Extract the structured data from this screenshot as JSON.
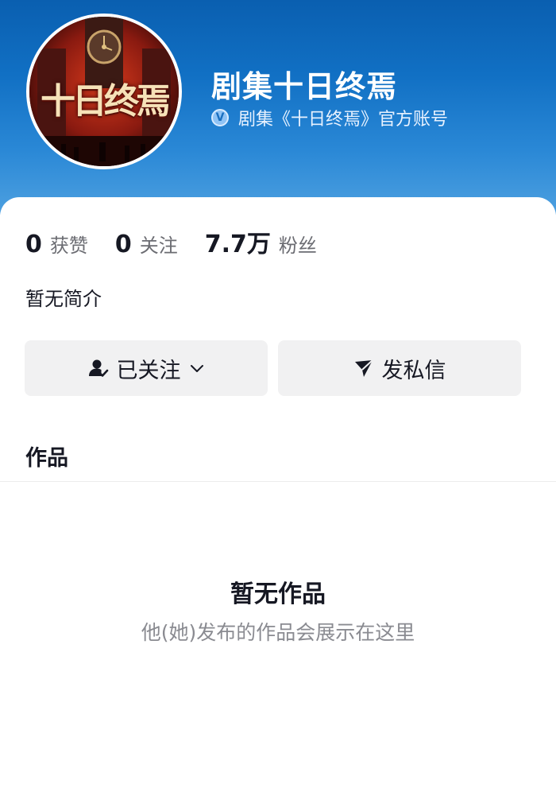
{
  "profile": {
    "name": "剧集十日终焉",
    "verification": "剧集《十日终焉》官方账号",
    "avatar_alt": "十日终焉"
  },
  "stats": [
    {
      "value": "0",
      "label": "获赞"
    },
    {
      "value": "0",
      "label": "关注"
    },
    {
      "value": "7.7万",
      "label": "粉丝"
    }
  ],
  "bio": "暂无简介",
  "actions": {
    "follow_label": "已关注",
    "message_label": "发私信"
  },
  "works": {
    "title": "作品",
    "empty_title": "暂无作品",
    "empty_subtitle": "他(她)发布的作品会展示在这里"
  },
  "icons": {
    "verify": "verified-badge-icon",
    "follow": "user-check-icon",
    "message": "send-plane-icon",
    "dropdown": "chevron-down-icon"
  },
  "colors": {
    "header_blue": "#1170c4",
    "button_bg": "#f1f1f2",
    "text_primary": "#161823",
    "text_secondary": "#6b6c72"
  }
}
